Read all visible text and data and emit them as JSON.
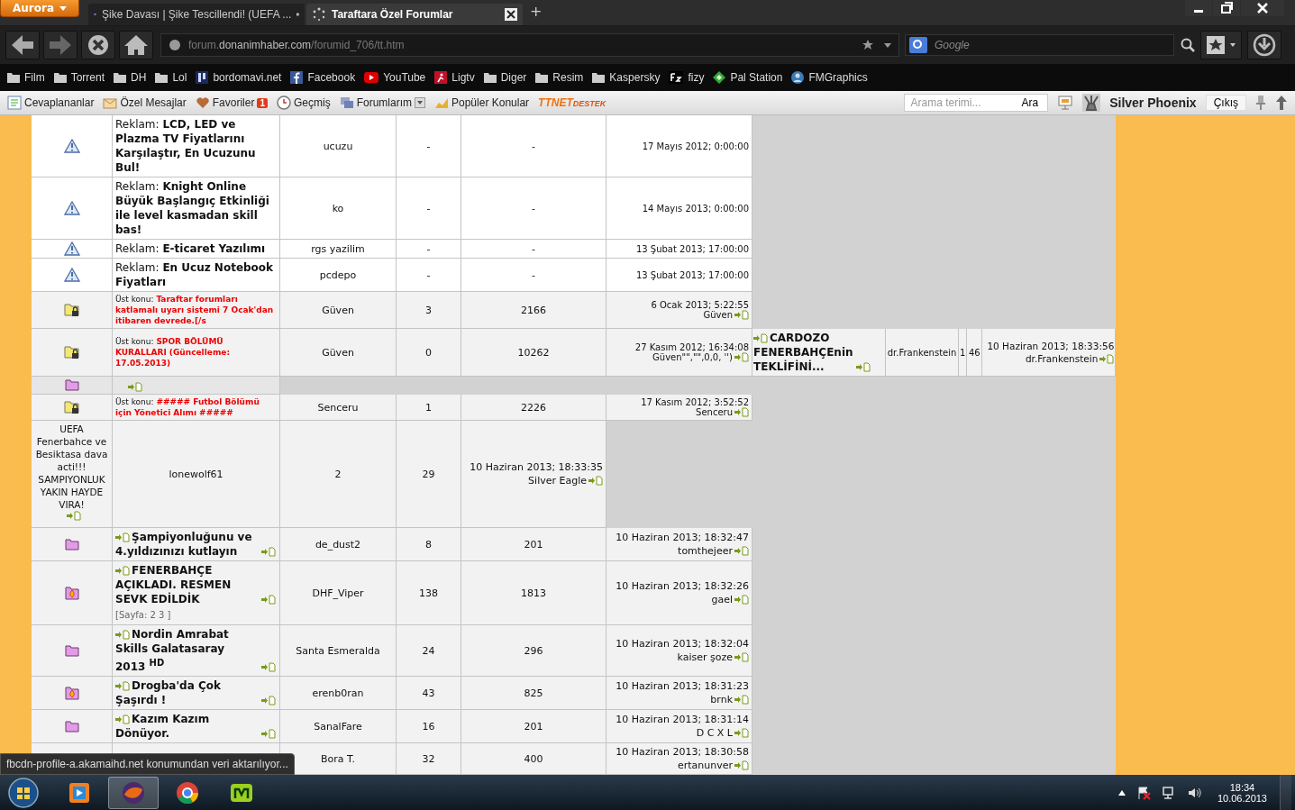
{
  "browser": {
    "menu_button": "Aurora",
    "tabs": [
      {
        "title": "Şike Davası | Şike Tescillendi! (UEFA ...",
        "selected": false
      },
      {
        "title": "Taraftara Özel Forumlar",
        "selected": true
      }
    ],
    "new_tab": "+",
    "url": {
      "prefix": "forum.",
      "domain": "donanimhaber.com",
      "path": "/forumid_706/tt.htm"
    },
    "search": {
      "placeholder": "Google"
    },
    "bookmarks": [
      "Film",
      "Torrent",
      "DH",
      "Lol",
      "bordomavi.net",
      "Facebook",
      "YouTube",
      "Ligtv",
      "Diger",
      "Resim",
      "Kaspersky",
      "fizy",
      "Pal Station",
      "FMGraphics"
    ]
  },
  "forum_toolbar": {
    "items": [
      {
        "label": "Cevaplananlar"
      },
      {
        "label": "Özel Mesajlar"
      },
      {
        "label": "Favoriler",
        "badge": "1"
      },
      {
        "label": "Geçmiş"
      },
      {
        "label": "Forumlarım"
      },
      {
        "label": "Popüler Konular"
      }
    ],
    "logo": {
      "main": "TTNET",
      "sub": "DESTEK"
    },
    "search": {
      "placeholder": "Arama terimi...",
      "button": "Ara"
    },
    "username": "Silver Phoenix",
    "logout": "Çıkış"
  },
  "rows": [
    {
      "kind": "ad",
      "cells": [
        {
          "kind": "warning"
        },
        {
          "kind": "ad",
          "prefix": "Reklam:",
          "title": "LCD, LED ve Plazma TV Fiyatlarını Karşılaştır, En Ucuzunu Bul!"
        },
        {
          "kind": "text",
          "text": "ucuzu"
        },
        {
          "kind": "text",
          "text": "-"
        },
        {
          "kind": "text",
          "text": "-"
        },
        {
          "kind": "last",
          "date": "17 Mayıs 2012; 0:00:00"
        }
      ]
    },
    {
      "kind": "ad",
      "cells": [
        {
          "kind": "warning"
        },
        {
          "kind": "ad",
          "prefix": "Reklam:",
          "title": "Knight Online Büyük Başlangıç Etkinliği ile level kasmadan skill bas!"
        },
        {
          "kind": "text",
          "text": "ko"
        },
        {
          "kind": "text",
          "text": "-"
        },
        {
          "kind": "text",
          "text": "-"
        },
        {
          "kind": "last",
          "date": "14 Mayıs 2013; 0:00:00"
        }
      ]
    },
    {
      "kind": "ad",
      "cells": [
        {
          "kind": "warning"
        },
        {
          "kind": "ad",
          "prefix": "Reklam:",
          "title": "E-ticaret Yazılımı"
        },
        {
          "kind": "text",
          "text": "rgs yazilim"
        },
        {
          "kind": "text",
          "text": "-"
        },
        {
          "kind": "text",
          "text": "-"
        },
        {
          "kind": "last",
          "date": "13 Şubat 2013; 17:00:00"
        }
      ]
    },
    {
      "kind": "ad",
      "cells": [
        {
          "kind": "warning"
        },
        {
          "kind": "ad",
          "prefix": "Reklam:",
          "title": "En Ucuz Notebook Fiyatları"
        },
        {
          "kind": "text",
          "text": "pcdepo"
        },
        {
          "kind": "text",
          "text": "-"
        },
        {
          "kind": "text",
          "text": "-"
        },
        {
          "kind": "last",
          "date": "13 Şubat 2013; 17:00:00"
        }
      ]
    },
    {
      "kind": "sticky",
      "cells": [
        {
          "kind": "locked"
        },
        {
          "kind": "sticky",
          "prefix": "Üst konu:",
          "title": "Taraftar forumları katlamalı uyarı sistemi 7 Ocak'dan itibaren devrede.[/s"
        },
        {
          "kind": "text",
          "text": "Güven"
        },
        {
          "kind": "text",
          "text": "3"
        },
        {
          "kind": "text",
          "text": "2166"
        },
        {
          "kind": "last",
          "date": "6 Ocak 2013; 5:22:55",
          "user": "Güven"
        }
      ]
    },
    {
      "kind": "sticky",
      "cells": [
        {
          "kind": "locked"
        },
        {
          "kind": "sticky",
          "prefix": "Üst konu:",
          "title": "SPOR BÖLÜMÜ KURALLARI (Güncelleme: 17.05.2013)"
        },
        {
          "kind": "text",
          "text": "Güven"
        },
        {
          "kind": "text",
          "text": "0"
        },
        {
          "kind": "text",
          "text": "10262"
        },
        {
          "kind": "last",
          "date": "27 Kasım 2012; 16:34:08",
          "user": "Güven\"\",\"\",0,0, '')"
        },
        {
          "kind": "topic",
          "title": "CARDOZO FENERBAHÇEnin TEKLİFİNİ..."
        },
        {
          "kind": "text",
          "text": "dr.Frankenstein"
        },
        {
          "kind": "text",
          "text": "1"
        },
        {
          "kind": "text",
          "text": "46"
        },
        {
          "kind": "last",
          "date": "10 Haziran 2013; 18:33:56",
          "user": "dr.Frankenstein"
        }
      ]
    },
    {
      "kind": "empty",
      "cells": [
        {
          "kind": "folder"
        },
        {
          "kind": "empty"
        }
      ]
    },
    {
      "kind": "sticky",
      "cells": [
        {
          "kind": "locked"
        },
        {
          "kind": "sticky",
          "prefix": "Üst konu:",
          "title": "##### Futbol Bölümü için Yönetici Alımı #####"
        },
        {
          "kind": "text",
          "text": "Senceru"
        },
        {
          "kind": "text",
          "text": "1"
        },
        {
          "kind": "text",
          "text": "2226"
        },
        {
          "kind": "last",
          "date": "17 Kasım 2012; 3:52:52",
          "user": "Senceru"
        }
      ]
    },
    {
      "kind": "topic",
      "cells": [
        {
          "kind": "plain",
          "title": "UEFA Fenerbahce ve Besiktasa dava acti!!! SAMPIYONLUK YAKIN HAYDE VIRA!"
        },
        {
          "kind": "text",
          "text": "lonewolf61"
        },
        {
          "kind": "text",
          "text": "2"
        },
        {
          "kind": "text",
          "text": "29"
        },
        {
          "kind": "last",
          "date": "10 Haziran 2013; 18:33:35",
          "user": "Silver Eagle"
        }
      ]
    },
    {
      "kind": "topic",
      "cells": [
        {
          "kind": "folder"
        },
        {
          "kind": "topic",
          "title": "Şampiyonluğunu ve 4.yıldızınızı kutlayın"
        },
        {
          "kind": "text",
          "text": "de_dust2"
        },
        {
          "kind": "text",
          "text": "8"
        },
        {
          "kind": "text",
          "text": "201"
        },
        {
          "kind": "last",
          "date": "10 Haziran 2013; 18:32:47",
          "user": "tomthejeer"
        }
      ]
    },
    {
      "kind": "topic",
      "cells": [
        {
          "kind": "hot"
        },
        {
          "kind": "topic",
          "title": "FENERBAHÇE AÇIKLADI. RESMEN SEVK EDİLDİK",
          "pages": "[Sayfa: 2 3 ]"
        },
        {
          "kind": "text",
          "text": "DHF_Viper"
        },
        {
          "kind": "text",
          "text": "138"
        },
        {
          "kind": "text",
          "text": "1813"
        },
        {
          "kind": "last",
          "date": "10 Haziran 2013; 18:32:26",
          "user": "gael"
        }
      ]
    },
    {
      "kind": "topic",
      "cells": [
        {
          "kind": "folder"
        },
        {
          "kind": "topic",
          "title": "Nordin Amrabat Skills Galatasaray 2013 $^{HD}$"
        },
        {
          "kind": "text",
          "text": "Santa Esmeralda"
        },
        {
          "kind": "text",
          "text": "24"
        },
        {
          "kind": "text",
          "text": "296"
        },
        {
          "kind": "last",
          "date": "10 Haziran 2013; 18:32:04",
          "user": "kaiser şoze"
        }
      ]
    },
    {
      "kind": "topic",
      "cells": [
        {
          "kind": "hot"
        },
        {
          "kind": "topic",
          "title": "Drogba'da Çok Şaşırdı !"
        },
        {
          "kind": "text",
          "text": "erenb0ran"
        },
        {
          "kind": "text",
          "text": "43"
        },
        {
          "kind": "text",
          "text": "825"
        },
        {
          "kind": "last",
          "date": "10 Haziran 2013; 18:31:23",
          "user": "brnk"
        }
      ]
    },
    {
      "kind": "topic",
      "cells": [
        {
          "kind": "folder"
        },
        {
          "kind": "topic",
          "title": "Kazım Kazım Dönüyor."
        },
        {
          "kind": "text",
          "text": "SanalFare"
        },
        {
          "kind": "text",
          "text": "16"
        },
        {
          "kind": "text",
          "text": "201"
        },
        {
          "kind": "last",
          "date": "10 Haziran 2013; 18:31:14",
          "user": "D C X L"
        }
      ]
    },
    {
      "kind": "topic",
      "cells": [
        {
          "kind": "hidden"
        },
        {
          "kind": "hidden"
        },
        {
          "kind": "text",
          "text": "Bora T."
        },
        {
          "kind": "text",
          "text": "32"
        },
        {
          "kind": "text",
          "text": "400"
        },
        {
          "kind": "last",
          "date": "10 Haziran 2013; 18:30:58",
          "user": "ertanunver"
        }
      ]
    }
  ],
  "status_text": "fbcdn-profile-a.akamaihd.net konumundan veri aktarılıyor...",
  "taskbar": {
    "apps": [
      {
        "selected": false
      },
      {
        "selected": true
      },
      {
        "selected": false
      },
      {
        "selected": false
      }
    ],
    "time": "18:34",
    "date": "10.06.2013"
  }
}
